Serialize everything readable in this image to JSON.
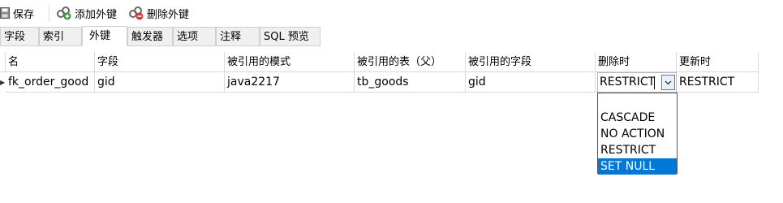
{
  "toolbar": {
    "save_label": "保存",
    "add_fk_label": "添加外键",
    "delete_fk_label": "删除外键"
  },
  "tabs": [
    {
      "label": "字段"
    },
    {
      "label": "索引"
    },
    {
      "label": "外键"
    },
    {
      "label": "触发器"
    },
    {
      "label": "选项"
    },
    {
      "label": "注释"
    },
    {
      "label": "SQL 预览"
    }
  ],
  "active_tab": "外键",
  "columns": [
    "名",
    "字段",
    "被引用的模式",
    "被引用的表（父）",
    "被引用的字段",
    "删除时",
    "更新时"
  ],
  "rows": [
    {
      "name": "fk_order_good",
      "field": "gid",
      "ref_schema": "java2217",
      "ref_table": "tb_goods",
      "ref_field": "gid",
      "on_delete": "RESTRICT",
      "on_update": "RESTRICT"
    }
  ],
  "dropdown": {
    "options": [
      "",
      "CASCADE",
      "NO ACTION",
      "RESTRICT",
      "SET NULL"
    ],
    "highlighted": "SET NULL"
  },
  "colors": {
    "selection": "#0078d7",
    "grid_line": "#d9d9d9",
    "tab_bg": "#f0f0f0"
  }
}
